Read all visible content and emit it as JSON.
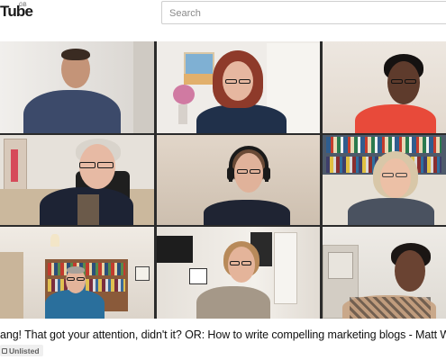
{
  "header": {
    "logo_text": "Tube",
    "logo_region": "GB",
    "search": {
      "placeholder": "Search",
      "value": ""
    }
  },
  "video": {
    "title": "ang! That got your attention, didn't it? OR: How to write compelling marketing blogs - Matt Wright",
    "visibility_badge": "Unlisted",
    "participants_count": 9
  }
}
